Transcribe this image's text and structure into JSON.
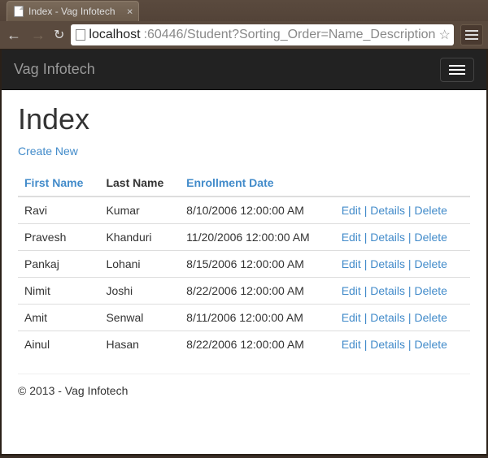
{
  "browser": {
    "tab_title": "Index - Vag Infotech",
    "url_host": "localhost",
    "url_path": ":60446/Student?Sorting_Order=Name_Description"
  },
  "navbar": {
    "brand": "Vag Infotech"
  },
  "page": {
    "heading": "Index",
    "create_new": "Create New",
    "headers": {
      "first_name": "First Name",
      "last_name": "Last Name",
      "enrollment_date": "Enrollment Date"
    },
    "actions": {
      "edit": "Edit",
      "details": "Details",
      "delete": "Delete"
    },
    "rows": [
      {
        "first": "Ravi",
        "last": "Kumar",
        "date": "8/10/2006 12:00:00 AM"
      },
      {
        "first": "Pravesh",
        "last": "Khanduri",
        "date": "11/20/2006 12:00:00 AM"
      },
      {
        "first": "Pankaj",
        "last": "Lohani",
        "date": "8/15/2006 12:00:00 AM"
      },
      {
        "first": "Nimit",
        "last": "Joshi",
        "date": "8/22/2006 12:00:00 AM"
      },
      {
        "first": "Amit",
        "last": "Senwal",
        "date": "8/11/2006 12:00:00 AM"
      },
      {
        "first": "Ainul",
        "last": "Hasan",
        "date": "8/22/2006 12:00:00 AM"
      }
    ],
    "footer": "© 2013 - Vag Infotech"
  }
}
